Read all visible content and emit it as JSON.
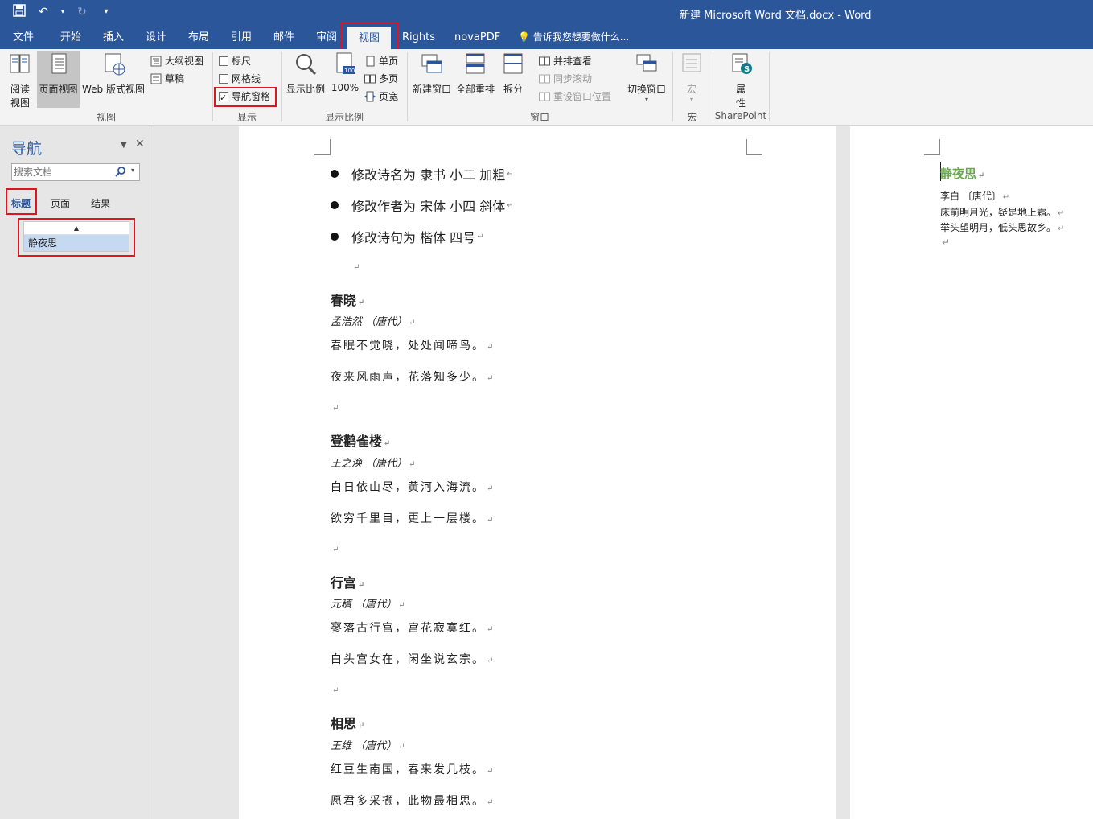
{
  "titlebar": {
    "title": "新建 Microsoft Word 文档.docx - Word"
  },
  "tabs": {
    "items": [
      "文件",
      "开始",
      "插入",
      "设计",
      "布局",
      "引用",
      "邮件",
      "审阅",
      "视图",
      "Rights",
      "novaPDF"
    ],
    "active": "视图",
    "tell_me": "告诉我您想要做什么..."
  },
  "ribbon": {
    "views": {
      "read_mode": "阅读视图",
      "read_mode_line1": "阅读",
      "read_mode_line2": "视图",
      "print_layout": "页面视图",
      "web_layout": "Web 版式视图",
      "outline": "大纲视图",
      "draft": "草稿",
      "group_label": "视图"
    },
    "show": {
      "ruler": "标尺",
      "ruler_checked": false,
      "gridlines": "网格线",
      "gridlines_checked": false,
      "nav_pane": "导航窗格",
      "nav_pane_checked": true,
      "group_label": "显示"
    },
    "zoom": {
      "zoom": "显示比例",
      "hundred": "100%",
      "one_page": "单页",
      "multi_page": "多页",
      "page_width": "页宽",
      "group_label": "显示比例"
    },
    "window": {
      "new_window": "新建窗口",
      "arrange_all": "全部重排",
      "split": "拆分",
      "side_by_side": "并排查看",
      "sync_scroll": "同步滚动",
      "reset_position": "重设窗口位置",
      "switch_windows": "切换窗口",
      "group_label": "窗口"
    },
    "macros": {
      "macros": "宏",
      "group_label": "宏"
    },
    "sharepoint": {
      "properties_line1": "属",
      "properties_line2": "性",
      "group_label": "SharePoint"
    }
  },
  "nav": {
    "title": "导航",
    "search_placeholder": "搜索文档",
    "tabs": [
      "标题",
      "页面",
      "结果"
    ],
    "active_tab": "标题",
    "headings": [
      "静夜思"
    ]
  },
  "page1": {
    "bullets": [
      "修改诗名为 隶书 小二 加粗",
      "修改作者为 宋体 小四 斜体",
      "修改诗句为 楷体 四号"
    ],
    "poems": [
      {
        "title": "春晓",
        "author": "孟浩然 （唐代）",
        "lines": [
          "春眠不觉晓，处处闻啼鸟。",
          "夜来风雨声，花落知多少。"
        ]
      },
      {
        "title": "登鹳雀楼",
        "author": "王之涣 （唐代）",
        "lines": [
          "白日依山尽，黄河入海流。",
          "欲穷千里目，更上一层楼。"
        ]
      },
      {
        "title": "行宫",
        "author": "元稹 （唐代）",
        "lines": [
          "寥落古行宫，宫花寂寞红。",
          "白头宫女在，闲坐说玄宗。"
        ]
      },
      {
        "title": "相思",
        "author": "王维 （唐代）",
        "lines": [
          "红豆生南国，春来发几枝。",
          "愿君多采撷，此物最相思。"
        ]
      }
    ]
  },
  "page2": {
    "title": "静夜思",
    "author": "李白 〔唐代〕",
    "line1": "床前明月光，疑是地上霜。",
    "line2": "举头望明月，低头思故乡。"
  },
  "colors": {
    "brand": "#2b579a",
    "highlight_box": "#e0141e",
    "heading_green": "#6aa84f"
  }
}
